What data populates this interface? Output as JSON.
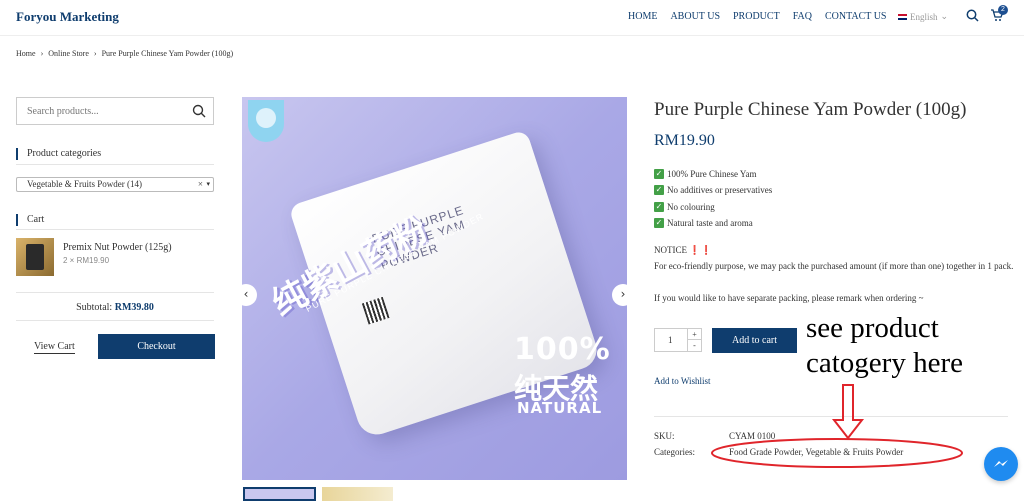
{
  "header": {
    "logo": "Foryou Marketing",
    "nav": [
      "HOME",
      "ABOUT US",
      "PRODUCT",
      "FAQ",
      "CONTACT US"
    ],
    "language": "English",
    "cart_count": "2"
  },
  "breadcrumb": [
    "Home",
    "Online Store",
    "Pure Purple Chinese Yam Powder (100g)"
  ],
  "sidebar": {
    "search_placeholder": "Search products...",
    "categories_title": "Product categories",
    "category_selected": "Vegetable & Fruits Powder  (14)",
    "cart_title": "Cart",
    "cart_item_name": "Premix Nut Powder (125g)",
    "cart_item_qty": "2 × RM19.90",
    "subtotal_label": "Subtotal:",
    "subtotal_value": "RM39.80",
    "view_cart": "View Cart",
    "checkout": "Checkout"
  },
  "gallery": {
    "cn_title": "纯紫山药粉",
    "cn_sub": "PURE PURPLE CHINESE YAM POWDER",
    "bag_label": "PURE PURPLE CHINESE YAM POWDER",
    "pct": "100%",
    "pct_cn": "纯天然",
    "natural": "NATURAL",
    "prev": "‹",
    "next": "›"
  },
  "product": {
    "title": "Pure Purple Chinese Yam Powder (100g)",
    "price": "RM19.90",
    "features": [
      "100% Pure Chinese Yam",
      "No additives or preservatives",
      "No colouring",
      "Natural taste and aroma"
    ],
    "notice_label": "NOTICE",
    "notice_bang": "❗❗",
    "notice_1": "For eco-friendly purpose, we may pack the purchased amount (if more than one) together in 1 pack.",
    "notice_2": "If you would like to have separate packing, please remark when ordering ~",
    "qty": "1",
    "add_to_cart": "Add to cart",
    "wishlist": "Add to Wishlist",
    "sku_label": "SKU:",
    "sku_value": "CYAM 0100",
    "cat_label": "Categories:",
    "cat_value": "Food Grade Powder, Vegetable & Fruits Powder"
  },
  "annotation": {
    "line1": "see product",
    "line2": "catogery here"
  }
}
